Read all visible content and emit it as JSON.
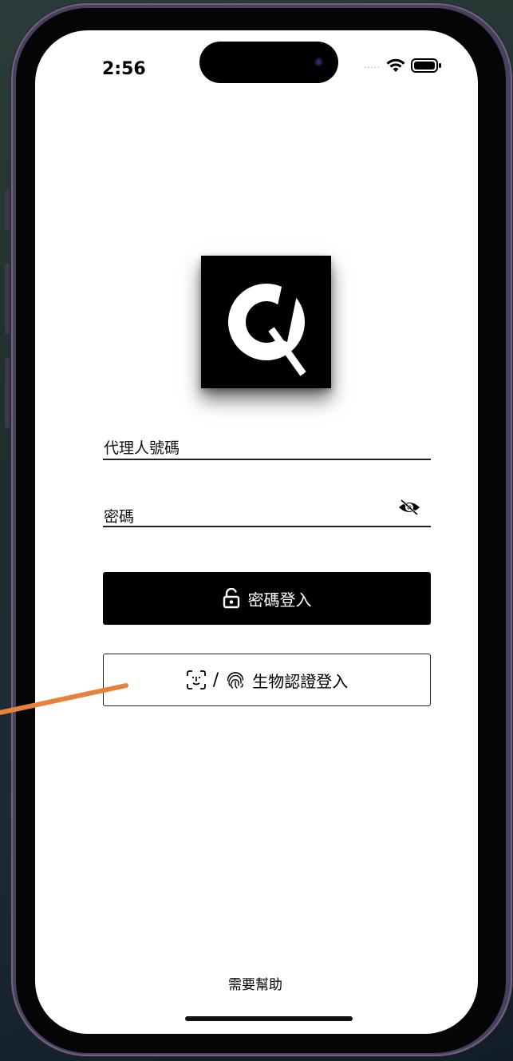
{
  "status_bar": {
    "time": "2:56",
    "signal_dots": ".....",
    "icons": [
      "wifi-icon",
      "battery-icon"
    ]
  },
  "logo": {
    "icon": "q-logo-icon",
    "bg_color": "#000000"
  },
  "form": {
    "agent_id_label": "代理人號碼",
    "password_label": "密碼",
    "password_toggle_icon": "eye-off-icon"
  },
  "buttons": {
    "password_login": {
      "label": "密碼登入",
      "icon": "lock-icon"
    },
    "biometric_login": {
      "label": "生物認證登入",
      "separator": "/",
      "icons": [
        "face-id-icon",
        "fingerprint-icon"
      ]
    }
  },
  "footer": {
    "help_label": "需要幫助"
  },
  "annotation": {
    "color": "#e8823a"
  }
}
